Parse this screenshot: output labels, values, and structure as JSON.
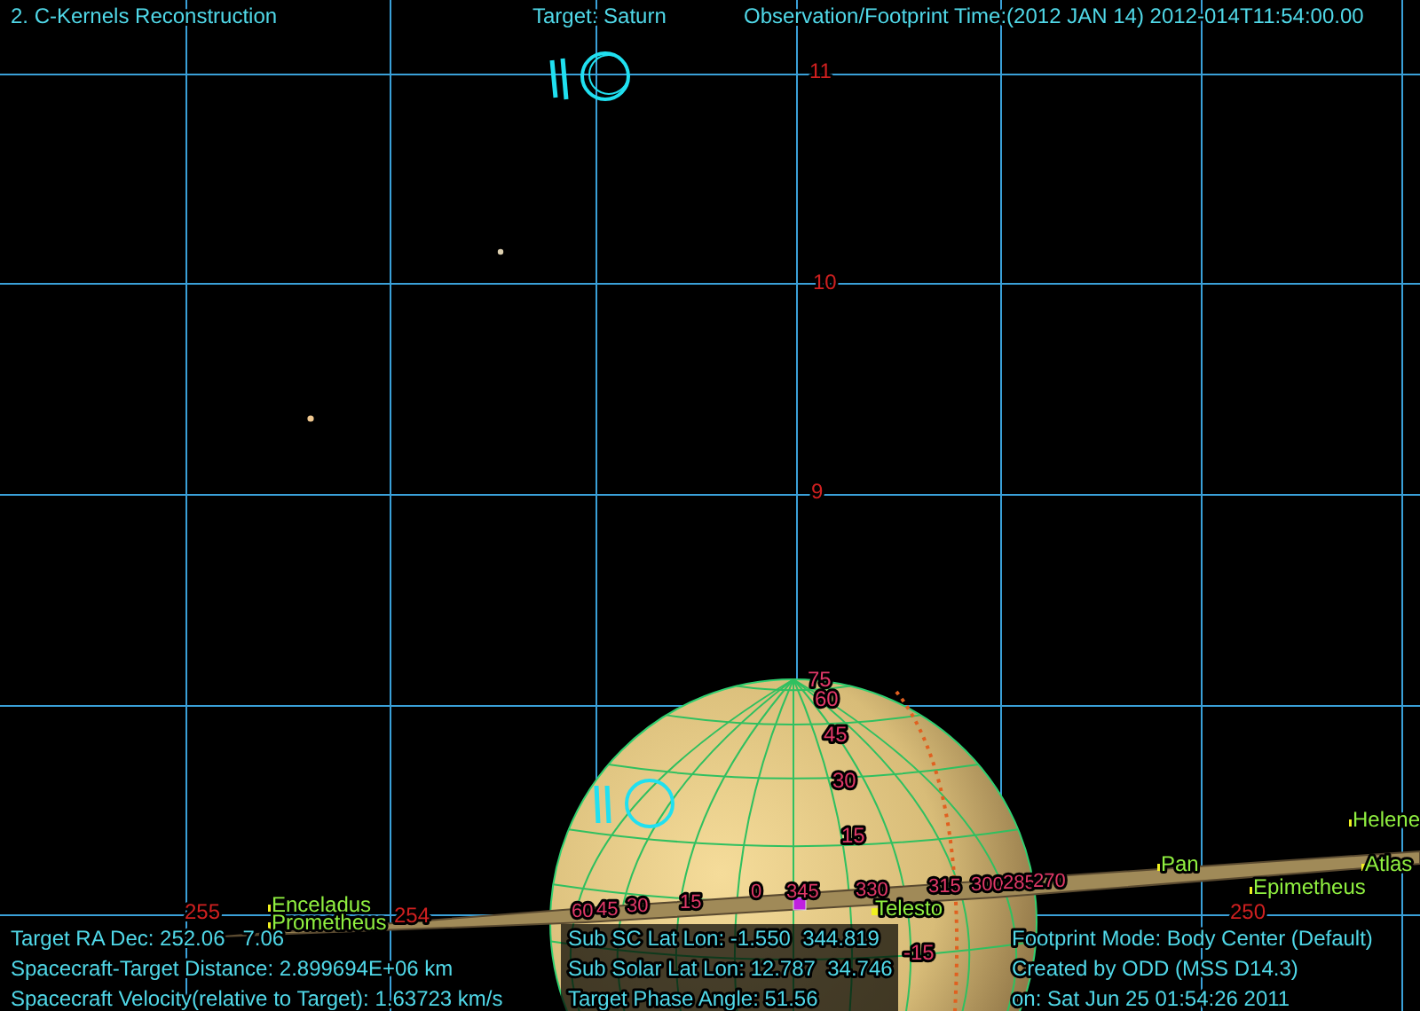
{
  "header": {
    "title": "2. C-Kernels Reconstruction",
    "target": "Target: Saturn",
    "time": "Observation/Footprint Time:(2012 JAN 14) 2012-014T11:54:00.00"
  },
  "sky_labels": [
    "11",
    "10",
    "9",
    "255",
    "254",
    "250"
  ],
  "planet_labels": [
    "75",
    "60",
    "45",
    "30",
    "15",
    "-15"
  ],
  "ring_labels": [
    "60",
    "45",
    "30",
    "15",
    "0",
    "345",
    "330",
    "315",
    "300",
    "285",
    "270"
  ],
  "moons": [
    {
      "name": "Helene"
    },
    {
      "name": "Enceladus"
    },
    {
      "name": "Prometheus"
    },
    {
      "name": "Telesto"
    },
    {
      "name": "Pan"
    },
    {
      "name": "Epimetheus"
    },
    {
      "name": "Atlas"
    }
  ],
  "info_left": [
    "Target RA Dec: 252.06   7.06",
    "Spacecraft-Target Distance: 2.899694E+06 km",
    "Spacecraft Velocity(relative to Target): 1.63723 km/s"
  ],
  "info_center": [
    "Sub SC Lat Lon: -1.550  344.819",
    "Sub Solar Lat Lon: 12.787  34.746",
    "Target Phase Angle: 51.56"
  ],
  "info_right": [
    "Footprint Mode: Body Center (Default)",
    "Created by ODD (MSS D14.3)",
    "on: Sat Jun 25 01:54:26 2011"
  ]
}
